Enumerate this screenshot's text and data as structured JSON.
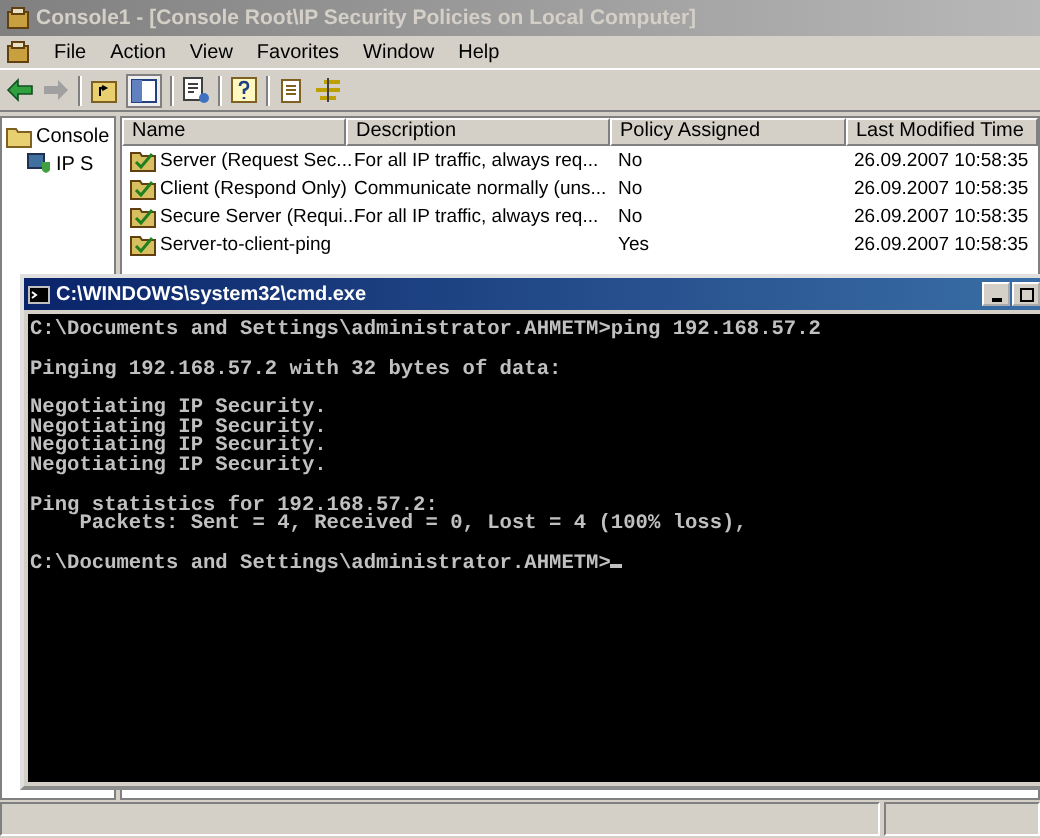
{
  "window": {
    "title": "Console1 - [Console Root\\IP Security Policies on Local Computer]"
  },
  "menu": [
    "File",
    "Action",
    "View",
    "Favorites",
    "Window",
    "Help"
  ],
  "tree": {
    "items": [
      {
        "label": "Console",
        "children": [
          {
            "label": "IP S"
          }
        ]
      }
    ]
  },
  "table": {
    "columns": [
      "Name",
      "Description",
      "Policy Assigned",
      "Last Modified Time"
    ],
    "rows": [
      {
        "name": "Server (Request Sec...",
        "description": "For all IP traffic, always req...",
        "assigned": "No",
        "modified": "26.09.2007 10:58:35"
      },
      {
        "name": "Client (Respond Only)",
        "description": "Communicate normally (uns...",
        "assigned": "No",
        "modified": "26.09.2007 10:58:35"
      },
      {
        "name": "Secure Server (Requi...",
        "description": "For all IP traffic, always req...",
        "assigned": "No",
        "modified": "26.09.2007 10:58:35"
      },
      {
        "name": "Server-to-client-ping",
        "description": "",
        "assigned": "Yes",
        "modified": "26.09.2007 10:58:35"
      }
    ]
  },
  "console": {
    "title": "C:\\WINDOWS\\system32\\cmd.exe",
    "cursor": true,
    "blocks": [
      [
        "C:\\Documents and Settings\\administrator.AHMETM>ping 192.168.57.2"
      ],
      [
        "Pinging 192.168.57.2 with 32 bytes of data:"
      ],
      [
        "Negotiating IP Security.",
        "Negotiating IP Security.",
        "Negotiating IP Security.",
        "Negotiating IP Security."
      ],
      [
        "Ping statistics for 192.168.57.2:",
        "    Packets: Sent = 4, Received = 0, Lost = 4 (100% loss),"
      ],
      [
        "C:\\Documents and Settings\\administrator.AHMETM>"
      ]
    ]
  }
}
